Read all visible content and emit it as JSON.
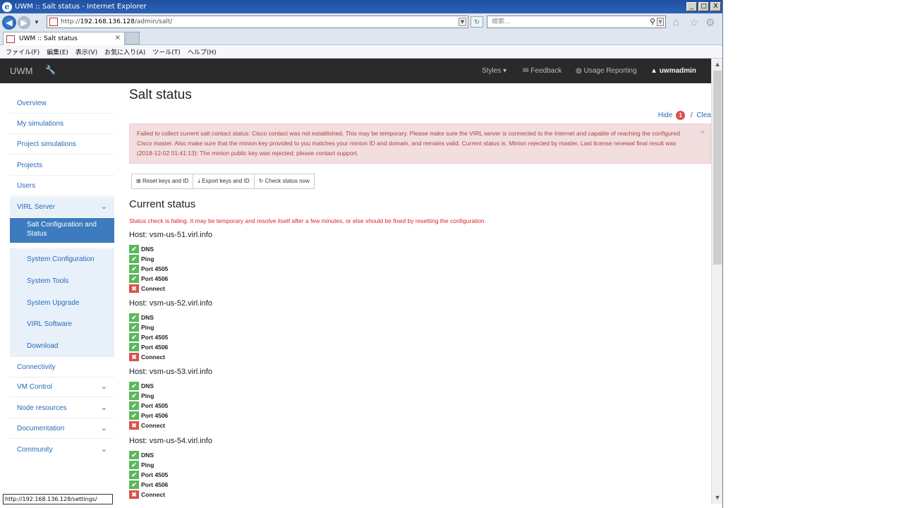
{
  "window": {
    "title": "UWM :: Salt status - Internet Explorer",
    "min": "_",
    "max": "□",
    "close": "X"
  },
  "browser": {
    "url_prefix": "http://",
    "url_host": "192.168.136.128",
    "url_path": "/admin/salt/",
    "search_placeholder": "検索...",
    "tab_title": "UWM :: Salt status",
    "tab_close": "×",
    "menu": [
      "ファイル(F)",
      "編集(E)",
      "表示(V)",
      "お気に入り(A)",
      "ツール(T)",
      "ヘルプ(H)"
    ],
    "status_url": "http://192.168.136.128/settings/"
  },
  "navbar": {
    "brand": "UWM",
    "styles": "Styles ▾",
    "feedback": "Feedback",
    "usage": "Usage Reporting",
    "user": "uwmadmin"
  },
  "sidebar": {
    "items": [
      {
        "label": "Overview"
      },
      {
        "label": "My simulations"
      },
      {
        "label": "Project simulations"
      },
      {
        "label": "Projects"
      },
      {
        "label": "Users"
      },
      {
        "label": "VIRL Server"
      },
      {
        "label": "Salt Configuration and Status"
      },
      {
        "label": "System Configuration"
      },
      {
        "label": "System Tools"
      },
      {
        "label": "System Upgrade"
      },
      {
        "label": "VIRL Software"
      },
      {
        "label": "Download"
      },
      {
        "label": "Connectivity"
      },
      {
        "label": "VM Control"
      },
      {
        "label": "Node resources"
      },
      {
        "label": "Documentation"
      },
      {
        "label": "Community"
      }
    ]
  },
  "main": {
    "title": "Salt status",
    "hide_label": "Hide",
    "hide_count": "1",
    "clear_label": "Clea",
    "alert": "Failed to collect current salt contact status: Cisco contact was not established. This may be temporary. Please make sure the VIRL server is connected to the Internet and capable of reaching the configured Cisco master. Also make sure that the minion key provided to you matches your minion ID and domain, and remains valid. Current status is: Minion rejected by master. Last license renewal final result was (2018-12-02 01:41:13): The minion public key was rejected; please contact support.",
    "buttons": {
      "reset": "Reset keys and ID",
      "export": "Export keys and ID",
      "check": "Check status now"
    },
    "current_status": "Current status",
    "status_message": "Status check is failing. It may be temporary and resolve itself after a few minutes, or else should be fixed by resetting the configuration.",
    "hosts": [
      {
        "name": "Host: vsm-us-51.virl.info",
        "checks": [
          {
            "label": "DNS",
            "ok": true
          },
          {
            "label": "Ping",
            "ok": true
          },
          {
            "label": "Port 4505",
            "ok": true
          },
          {
            "label": "Port 4506",
            "ok": true
          },
          {
            "label": "Connect",
            "ok": false
          }
        ]
      },
      {
        "name": "Host: vsm-us-52.virl.info",
        "checks": [
          {
            "label": "DNS",
            "ok": true
          },
          {
            "label": "Ping",
            "ok": true
          },
          {
            "label": "Port 4505",
            "ok": true
          },
          {
            "label": "Port 4506",
            "ok": true
          },
          {
            "label": "Connect",
            "ok": false
          }
        ]
      },
      {
        "name": "Host: vsm-us-53.virl.info",
        "checks": [
          {
            "label": "DNS",
            "ok": true
          },
          {
            "label": "Ping",
            "ok": true
          },
          {
            "label": "Port 4505",
            "ok": true
          },
          {
            "label": "Port 4506",
            "ok": true
          },
          {
            "label": "Connect",
            "ok": false
          }
        ]
      },
      {
        "name": "Host: vsm-us-54.virl.info",
        "checks": [
          {
            "label": "DNS",
            "ok": true
          },
          {
            "label": "Ping",
            "ok": true
          },
          {
            "label": "Port 4505",
            "ok": true
          },
          {
            "label": "Port 4506",
            "ok": true
          },
          {
            "label": "Connect",
            "ok": false
          }
        ]
      }
    ]
  },
  "colors": {
    "ok": "#5cb85c",
    "fail": "#d9534f",
    "link": "#2a6ab8",
    "alert_bg": "#f2dede"
  }
}
